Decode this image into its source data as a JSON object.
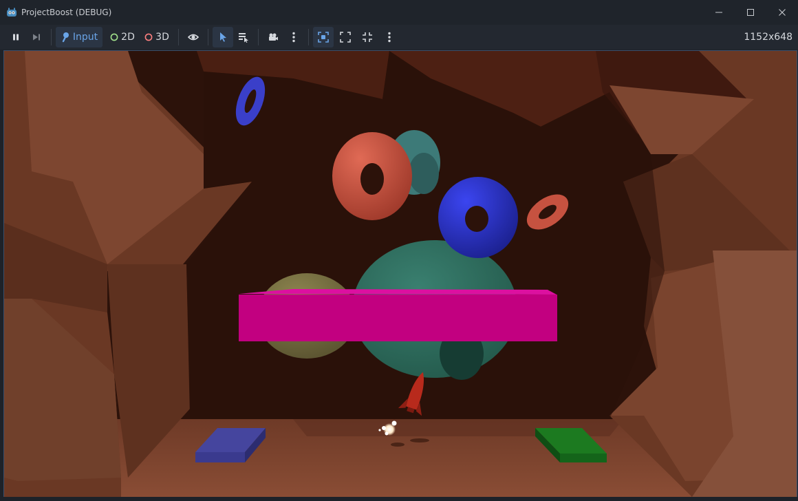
{
  "window": {
    "title": "ProjectBoost (DEBUG)",
    "icon": "godot-icon",
    "controls": [
      "minimize-icon",
      "maximize-icon",
      "close-icon"
    ]
  },
  "toolbar": {
    "pause": "pause-icon",
    "next_frame": "next-frame-icon",
    "input_label": "Input",
    "label_2d": "2D",
    "label_3d": "3D",
    "visibility": "eye-icon",
    "select": "select-cursor-icon",
    "list_select": "list-select-icon",
    "camera": "camera-icon",
    "more1": "kebab-menu-icon",
    "camera_override": "camera-override-icon",
    "fullscreen": "expand-icon",
    "shrink": "shrink-icon",
    "more2": "kebab-menu-icon",
    "resolution": "1152x648"
  },
  "scene": {
    "description_free": true,
    "colors": {
      "cave_dark": "#2c120a",
      "cave_wall": "#6a3a26",
      "floor": "#7d4631",
      "pink_bar": "#c20080",
      "teal_sphere": "#2f6f5f",
      "olive_sphere": "#77703f",
      "blue_torus": "#2a31c8",
      "orange_torus": "#c65240",
      "teal_torus": "#3d7a78",
      "blue_pad": "#3d3da0",
      "green_pad": "#1a7a20",
      "rocket": "#b82a1c"
    }
  }
}
